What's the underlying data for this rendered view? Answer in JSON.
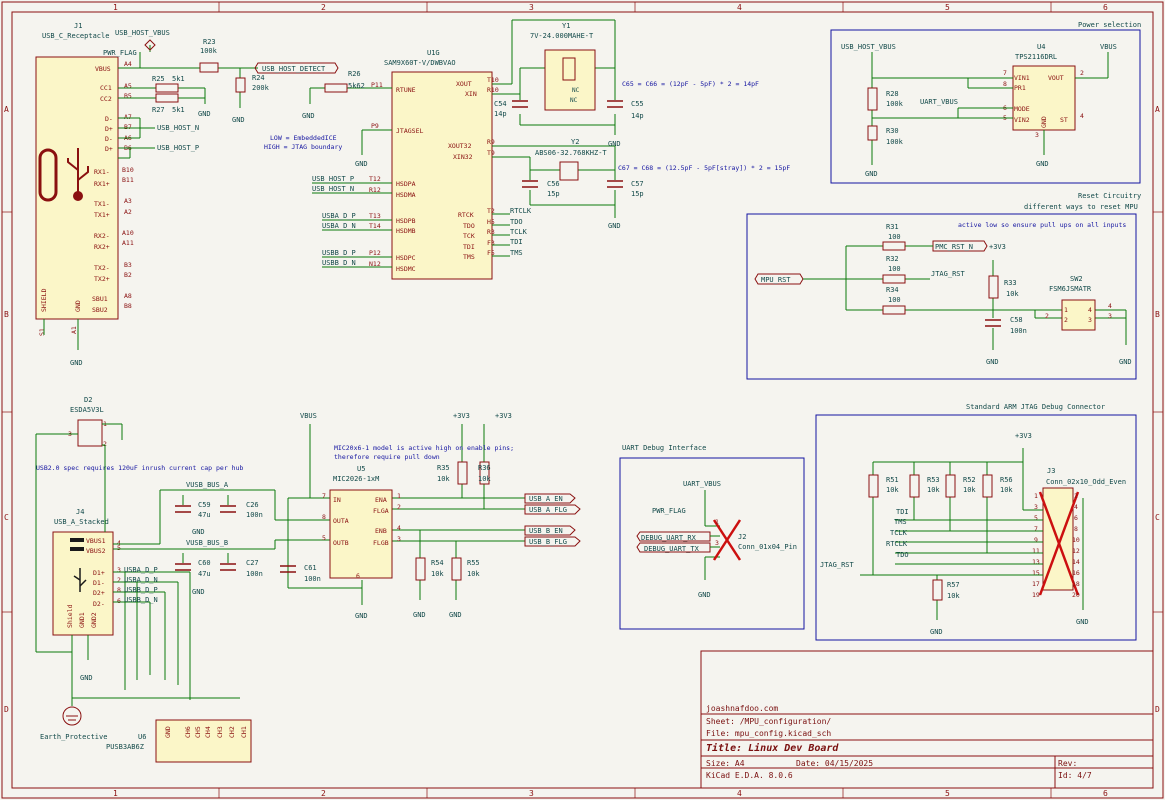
{
  "border": {
    "cols": [
      "1",
      "2",
      "3",
      "4",
      "5",
      "6"
    ],
    "rows": [
      "A",
      "B",
      "C",
      "D"
    ]
  },
  "colors": {
    "wire": "#0b7a0b",
    "component": "#8a1010",
    "label_text": "#134a4a",
    "note_text": "#1414a0",
    "sheet_border": "#8a1010",
    "background": "#f5f4ef"
  },
  "j1": {
    "ref": "J1",
    "value": "USB_C_Receptacle",
    "pins_left": [
      "VBUS",
      "CC1",
      "CC2",
      "D-",
      "D+",
      "D-",
      "D+",
      "RX1-",
      "RX1+",
      "TX1-",
      "TX1+",
      "RX2-",
      "RX2+",
      "TX2-",
      "TX2+",
      "SBU1",
      "SBU2"
    ],
    "pin_nums": [
      "A4",
      "A5",
      "B5",
      "A7",
      "B7",
      "A6",
      "B6",
      "B10",
      "B11",
      "A3",
      "A2",
      "A10",
      "A11",
      "B3",
      "B2",
      "A8",
      "B8"
    ],
    "shield": "SHIELD",
    "gnd": "GND",
    "s1": "S1",
    "a1": "A1"
  },
  "netlabels": {
    "usb_host_vbus": "USB_HOST_VBUS",
    "pwr_flag": "PWR_FLAG",
    "usb_host_detect": "USB_HOST_DETECT",
    "usb_host_n": "USB_HOST_N",
    "usb_host_p": "USB_HOST_P",
    "mpu_rst": "MPU_RST",
    "pmc_rst_n": "PMC_RST_N",
    "jtag_rst": "JTAG_RST",
    "usb_a_en": "USB_A_EN",
    "usb_a_flg": "USB_A_FLG",
    "usb_b_en": "USB_B_EN",
    "usb_b_flg": "USB_B_FLG",
    "debug_uart_rx": "DEBUG_UART_RX",
    "debug_uart_tx": "DEBUG_UART_TX",
    "vusb_bus_a": "VUSB_BUS_A",
    "vusb_bus_b": "VUSB_BUS_B",
    "uart_vbus": "UART_VBUS",
    "plus3v3": "+3V3",
    "vbus": "VBUS",
    "gnd": "GND",
    "earth": "Earth_Protective",
    "usba_d_p": "USBA_D_P",
    "usba_d_n": "USBA_D_N",
    "usbb_d_p": "USBB_D_P",
    "usbb_d_n": "USBB_D_N",
    "usb_host_p2": "USB_HOST_P",
    "usb_host_n2": "USB_HOST_N",
    "rtclk": "RTCLK",
    "tdo": "TDO",
    "tclk": "TCLK",
    "tdi": "TDI",
    "tms": "TMS"
  },
  "resistors": {
    "r23": [
      "R23",
      "100k"
    ],
    "r24": [
      "R24",
      "200k"
    ],
    "r25": [
      "R25",
      "5k1"
    ],
    "r27": [
      "R27",
      "5k1"
    ],
    "r26": [
      "R26",
      "5k62"
    ],
    "r28": [
      "R28",
      "100k"
    ],
    "r30": [
      "R30",
      "100k"
    ],
    "r31": [
      "R31",
      "100"
    ],
    "r32": [
      "R32",
      "100"
    ],
    "r34": [
      "R34",
      "100"
    ],
    "r33": [
      "R33",
      "10k"
    ],
    "r35": [
      "R35",
      "10k"
    ],
    "r36": [
      "R36",
      "10k"
    ],
    "r54": [
      "R54",
      "10k"
    ],
    "r55": [
      "R55",
      "10k"
    ],
    "r51": [
      "R51",
      "10k"
    ],
    "r53": [
      "R53",
      "10k"
    ],
    "r52": [
      "R52",
      "10k"
    ],
    "r56": [
      "R56",
      "10k"
    ],
    "r57": [
      "R57",
      "10k"
    ]
  },
  "caps": {
    "c54": [
      "C54",
      "14p"
    ],
    "c55": [
      "C55",
      "14p"
    ],
    "c56": [
      "C56",
      "15p"
    ],
    "c57": [
      "C57",
      "15p"
    ],
    "c58": [
      "C58",
      "100n"
    ],
    "c59": [
      "C59",
      "47u"
    ],
    "c26": [
      "C26",
      "100n"
    ],
    "c60": [
      "C60",
      "47u"
    ],
    "c27": [
      "C27",
      "100n"
    ],
    "c61": [
      "C61",
      "100n"
    ]
  },
  "u1": {
    "ref": "U1G",
    "value": "SAM9X60T-V/DWBVAO",
    "left_pins": [
      [
        "P11",
        "RTUNE"
      ],
      [
        "P9",
        "JTAGSEL"
      ],
      [
        "T12",
        "HSDPA"
      ],
      [
        "R12",
        "HSDMA"
      ],
      [
        "T13",
        "HSDPB"
      ],
      [
        "T14",
        "HSDMB"
      ],
      [
        "P12",
        "HSDPC"
      ],
      [
        "N12",
        "HSDMC"
      ]
    ],
    "right_pins": [
      [
        "T10",
        "XOUT"
      ],
      [
        "R10",
        "XIN"
      ],
      [
        "R9",
        "XOUT32"
      ],
      [
        "T9",
        "XIN32"
      ],
      [
        "T2",
        "RTCK"
      ],
      [
        "H5",
        "TDO"
      ],
      [
        "R3",
        "TCK"
      ],
      [
        "F3",
        "TDI"
      ],
      [
        "F5",
        "TMS"
      ]
    ],
    "note1": "LOW = EmbeddedICE",
    "note2": "HIGH = JTAG boundary"
  },
  "y1": {
    "ref": "Y1",
    "value": "7V-24.000MAHE-T",
    "nc": "NC"
  },
  "y2": {
    "ref": "Y2",
    "value": "ABS06-32.768KHZ-T"
  },
  "notes": {
    "c65": "C65 = C66 = (12pF - 5pF) * 2 = 14pF",
    "c67": "C67 = C68 = (12.5pF - 5pF[stray]) * 2 = 15pF",
    "usb_inrush": "USB2.0 spec requires 120uF inrush current cap per hub",
    "mic_note1": "MIC20x6-1 model is active high on enable pins;",
    "mic_note2": "therefore require pull down",
    "reset_note": "active low so ensure pull ups on all inputs"
  },
  "power": {
    "title": "Power selection",
    "u4_ref": "U4",
    "u4_val": "TPS2116DRL",
    "pins_left": [
      "VIN1",
      "PR1",
      "MODE",
      "VIN2"
    ],
    "pin_nums_left": [
      "7",
      "8",
      "6",
      "5"
    ],
    "pins_right": [
      "VOUT",
      "ST"
    ],
    "pin_nums_right": [
      "2",
      "4"
    ],
    "gnd_pin": "GND",
    "gnd_num": "3"
  },
  "reset": {
    "title": "Reset Circuitry",
    "subtitle": "different ways to reset MPU",
    "sw_ref": "SW2",
    "sw_val": "FSM6JSMATR",
    "pins": [
      "1",
      "2",
      "3",
      "4"
    ]
  },
  "jtag": {
    "title": "Standard ARM JTAG Debug  Connector",
    "ref": "J3",
    "val": "Conn_02x10_Odd_Even",
    "nums_left": [
      "1",
      "3",
      "5",
      "7",
      "9",
      "11",
      "13",
      "15",
      "17",
      "19"
    ],
    "nums_right": [
      "2",
      "4",
      "6",
      "8",
      "10",
      "12",
      "14",
      "16",
      "18",
      "20"
    ]
  },
  "uart": {
    "title": "UART Debug Interface",
    "ref": "J2",
    "val": "Conn_01x04_Pin",
    "pins": [
      "1",
      "2",
      "3",
      "4"
    ]
  },
  "d2": {
    "ref": "D2",
    "val": "ESDA5V3L",
    "pins": [
      "1",
      "2",
      "3"
    ]
  },
  "j4": {
    "ref": "J4",
    "val": "USB_A_Stacked",
    "pins": [
      "VBUS1",
      "VBUS2",
      "D1+",
      "D1-",
      "D2+",
      "D2-"
    ],
    "nums": [
      "4",
      "5",
      "3",
      "2",
      "8",
      "6"
    ],
    "bottom": [
      "Shield",
      "GND1",
      "GND2"
    ]
  },
  "u5": {
    "ref": "U5",
    "val": "MIC2026-1xM",
    "pins_left": [
      "IN",
      "OUTA",
      "OUTB"
    ],
    "nums_left": [
      "7",
      "8",
      "5"
    ],
    "pins_right": [
      "ENA",
      "FLGA",
      "ENB",
      "FLGB"
    ],
    "nums_right": [
      "1",
      "2",
      "4",
      "3"
    ],
    "gnd_num": "6"
  },
  "u6": {
    "ref": "U6",
    "val": "PUSB3AB6Z",
    "pins": [
      "GND",
      "CH6",
      "CH5",
      "CH4",
      "CH3",
      "CH2",
      "CH1"
    ]
  },
  "titleblock": {
    "author": "joashnafdoo.com",
    "sheet": "Sheet: /MPU_configuration/",
    "file": "File: mpu_config.kicad_sch",
    "title": "Title: Linux Dev Board",
    "size": "Size: A4",
    "date": "Date: 04/15/2025",
    "rev": "Rev:",
    "tool": "KiCad E.D.A. 8.0.6",
    "id": "Id: 4/7"
  }
}
